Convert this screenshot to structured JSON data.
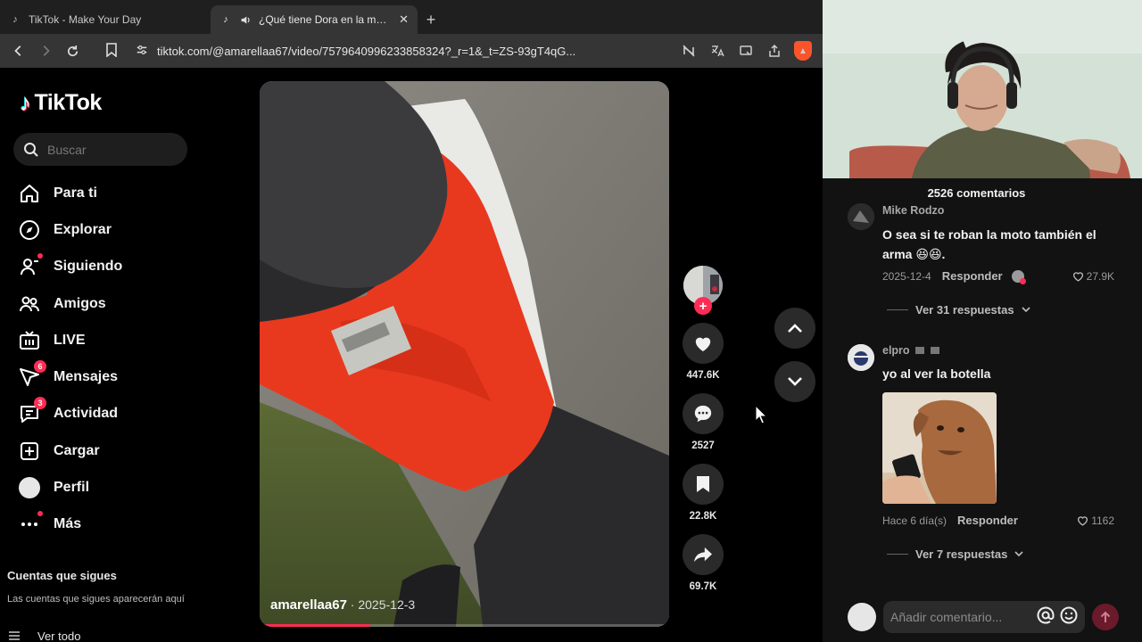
{
  "browser": {
    "tabs": [
      {
        "title": "TikTok - Make Your Day",
        "active": false,
        "icon": "tiktok-icon"
      },
      {
        "title": "¿Qué tiene Dora en la mochila?",
        "active": true,
        "icon": "tiktok-icon",
        "audio_icon": "speaker-icon"
      }
    ],
    "new_tab_label": "+",
    "url": "tiktok.com/@amarellaa67/video/7579640996233858324?_r=1&_t=ZS-93gT4qG..."
  },
  "sidebar": {
    "logo_text": "TikTok",
    "search_placeholder": "Buscar",
    "nav": [
      {
        "label": "Para ti",
        "icon": "home-icon"
      },
      {
        "label": "Explorar",
        "icon": "compass-icon"
      },
      {
        "label": "Siguiendo",
        "icon": "following-icon"
      },
      {
        "label": "Amigos",
        "icon": "friends-icon"
      },
      {
        "label": "LIVE",
        "icon": "live-icon"
      },
      {
        "label": "Mensajes",
        "icon": "messages-icon",
        "badge": "6"
      },
      {
        "label": "Actividad",
        "icon": "activity-icon",
        "badge": "3"
      },
      {
        "label": "Cargar",
        "icon": "upload-icon"
      },
      {
        "label": "Perfil",
        "icon": "avatar"
      },
      {
        "label": "Más",
        "icon": "more-icon"
      }
    ],
    "following_title": "Cuentas que sigues",
    "following_desc": "Las cuentas que sigues aparecerán aquí",
    "see_all": "Ver todo"
  },
  "video": {
    "username": "amarellaa67",
    "date_sep": " · ",
    "date": "2025-12-3",
    "progress": 0.27
  },
  "actions": {
    "likes": "447.6K",
    "comments": "2527",
    "saves": "22.8K",
    "shares": "69.7K"
  },
  "comments_panel": {
    "title": "2526 comentarios",
    "items": [
      {
        "name": "Mike Rodzo",
        "text": "O sea si te roban la moto también el arma 😆😆.",
        "date": "2025-12-4",
        "reply_label": "Responder",
        "likes": "27.9K",
        "replies_label": "Ver 31 respuestas"
      },
      {
        "name": "elpro",
        "text": "yo al ver la botella",
        "date": "Hace 6 día(s)",
        "reply_label": "Responder",
        "likes": "1162",
        "replies_label": "Ver 7 respuestas"
      }
    ],
    "input_placeholder": "Añadir comentario..."
  },
  "colors": {
    "accent": "#fe2c55",
    "background": "#000000",
    "panel": "#121212"
  }
}
